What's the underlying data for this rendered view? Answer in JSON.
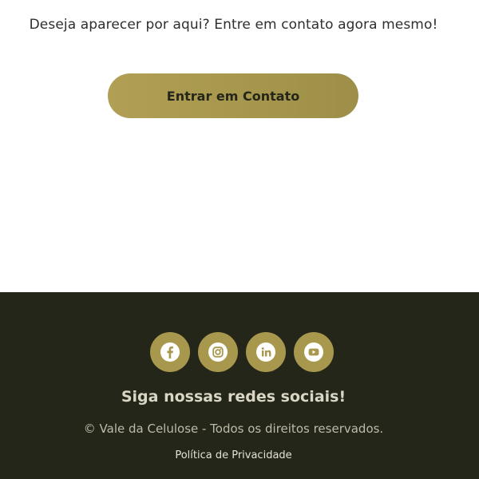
{
  "cta": {
    "text": "Deseja aparecer por aqui? Entre em contato agora mesmo!",
    "button_label": "Entrar em Contato"
  },
  "footer": {
    "social_icons": [
      "facebook-icon",
      "instagram-icon",
      "linkedin-icon",
      "youtube-icon"
    ],
    "follow_title": "Siga nossas redes sociais!",
    "copyright": "© Vale da Celulose - Todos os direitos reservados.",
    "privacy_link": "Política de Privacidade"
  },
  "colors": {
    "accent": "#a8984e",
    "footer_bg": "#25261a",
    "text_dark": "#2e2e2e"
  }
}
